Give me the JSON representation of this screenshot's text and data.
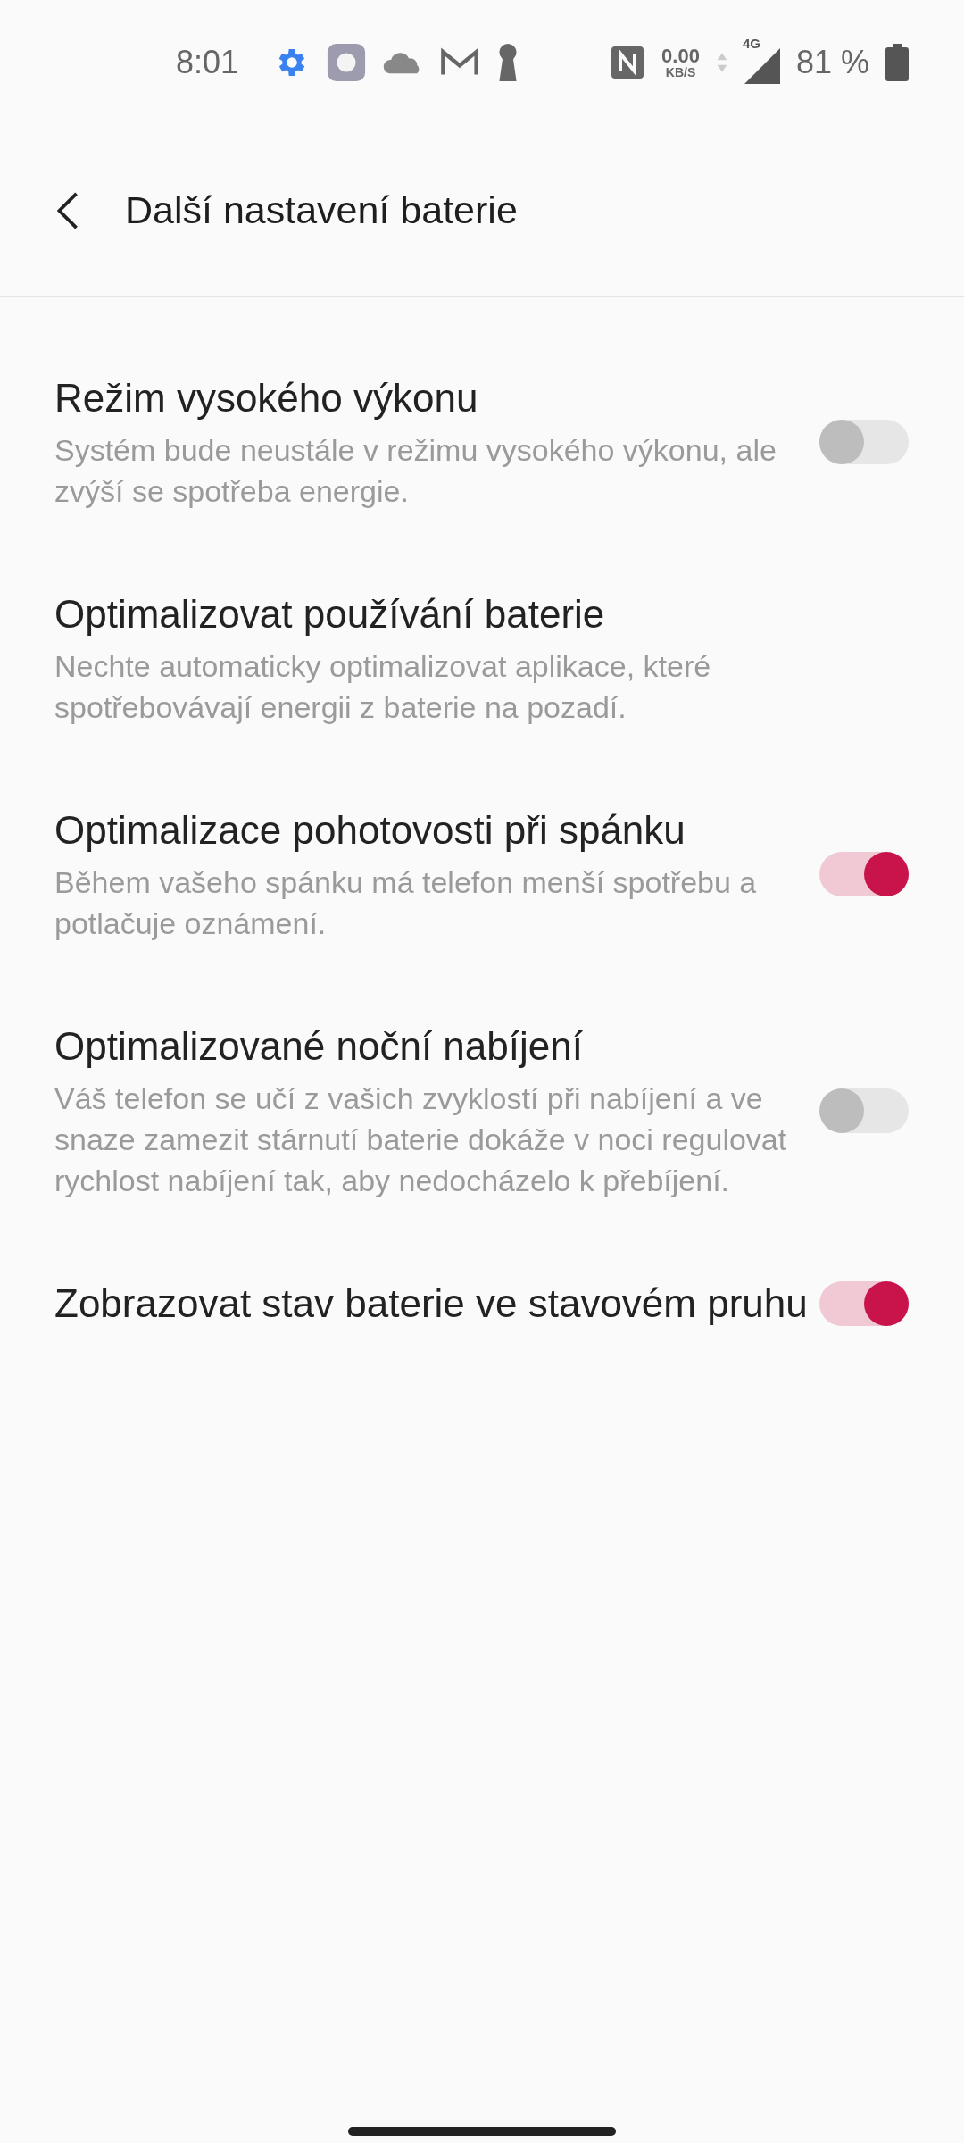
{
  "status_bar": {
    "time": "8:01",
    "net_speed": "0.00",
    "net_unit": "KB/S",
    "network": "4G",
    "battery": "81 %"
  },
  "header": {
    "title": "Další nastavení baterie"
  },
  "settings": [
    {
      "kind": "switch",
      "title": "Režim vysokého výkonu",
      "description": "Systém bude neustále v režimu vysokého výkonu, ale zvýší se spotřeba energie.",
      "on": false
    },
    {
      "kind": "plain",
      "title": "Optimalizovat používání baterie",
      "description": "Nechte automaticky optimalizovat aplikace, které spotřebovávají energii z baterie na pozadí."
    },
    {
      "kind": "switch",
      "title": "Optimalizace pohotovosti při spánku",
      "description": "Během vašeho spánku má telefon menší spotřebu a potlačuje oznámení.",
      "on": true
    },
    {
      "kind": "switch",
      "title": "Optimalizované noční nabíjení",
      "description": "Váš telefon se učí z vašich zvyklostí při nabíjení a ve snaze zamezit stárnutí baterie dokáže v noci regulovat rychlost nabíjení tak, aby nedocházelo k přebíjení.",
      "on": false
    },
    {
      "kind": "switch",
      "title": "Zobrazovat stav baterie ve stavovém pruhu",
      "on": true
    }
  ]
}
